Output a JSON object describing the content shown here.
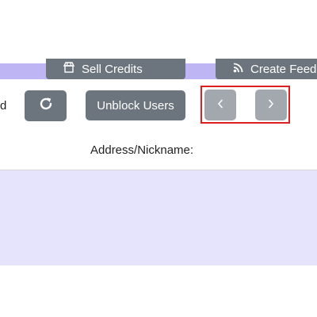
{
  "top_tabs": {
    "sell_credits": {
      "label": "Sell Credits",
      "icon": "store-icon"
    },
    "create_feed": {
      "label": "Create Feed",
      "icon": "rss-icon"
    }
  },
  "toolbar": {
    "partial_label": "d",
    "refresh_icon": "refresh-icon",
    "unblock_label": "Unblock Users",
    "prev_icon": "chevron-left-icon",
    "next_icon": "chevron-right-icon"
  },
  "form": {
    "address_label": "Address/Nickname:"
  },
  "colors": {
    "strip": "#bdb5f4",
    "button": "#6c757d",
    "pager_button": "#a2a8ae",
    "highlight": "#dc1f1f",
    "list_area": "#e6e4fd"
  }
}
